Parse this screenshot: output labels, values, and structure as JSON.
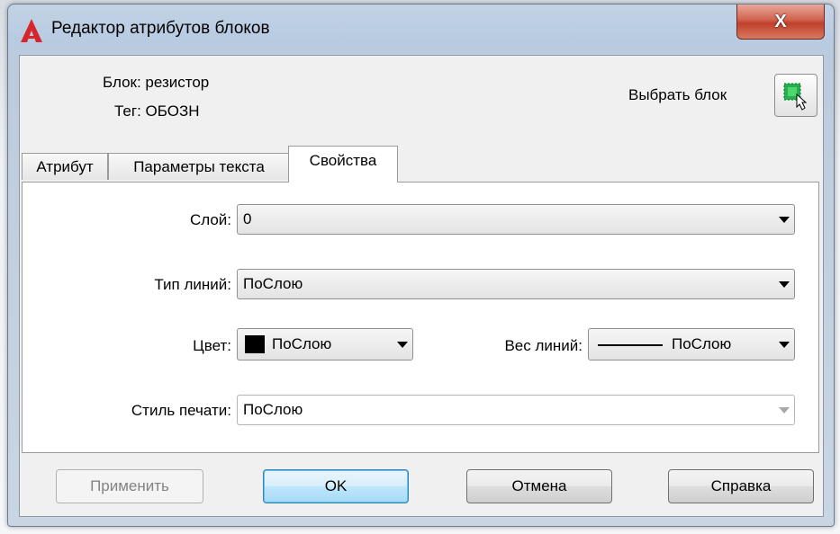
{
  "window": {
    "title": "Редактор атрибутов блоков",
    "close_glyph": "X"
  },
  "info": {
    "block_label": "Блок: резистор",
    "tag_label": "Тег: ОБОЗН",
    "pick_label": "Выбрать блок"
  },
  "tabs": [
    {
      "label": "Атрибут",
      "active": false
    },
    {
      "label": "Параметры текста",
      "active": false
    },
    {
      "label": "Свойства",
      "active": true
    }
  ],
  "properties": {
    "layer": {
      "label": "Слой:",
      "value": "0"
    },
    "linetype": {
      "label": "Тип линий:",
      "value": "ПоСлою"
    },
    "color": {
      "label": "Цвет:",
      "value": "ПоСлою",
      "swatch": "#000000"
    },
    "lineweight": {
      "label": "Вес линий:",
      "value": "ПоСлою"
    },
    "plotstyle": {
      "label": "Стиль печати:",
      "value": "ПоСлою",
      "enabled": false
    }
  },
  "buttons": {
    "apply": "Применить",
    "ok": "OK",
    "cancel": "Отмена",
    "help": "Справка"
  },
  "colors": {
    "accent": "#3c7fb1",
    "close": "#c1402a",
    "app_icon": "#d6262c"
  }
}
